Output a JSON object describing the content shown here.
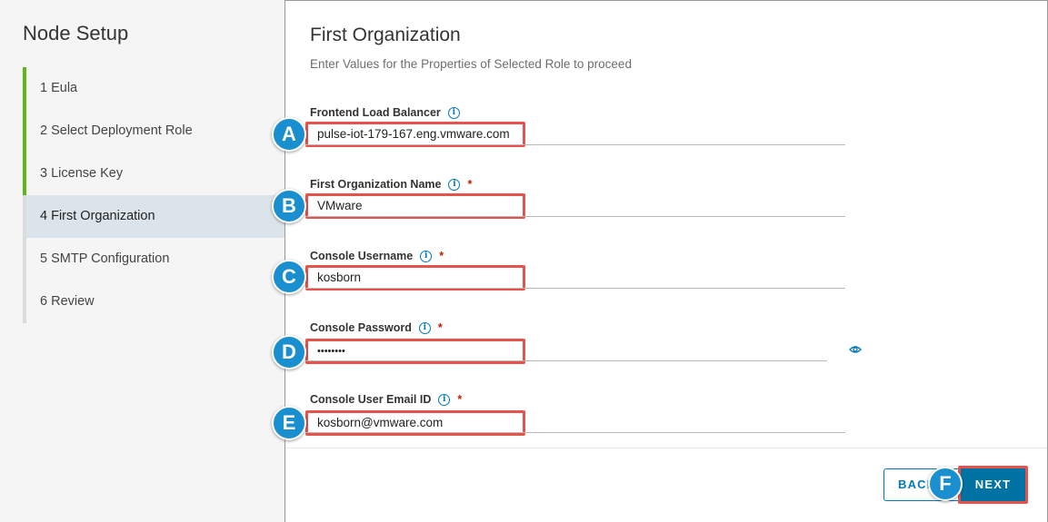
{
  "sidebar": {
    "title": "Node Setup",
    "steps": [
      {
        "label": "1  Eula"
      },
      {
        "label": "2  Select Deployment Role"
      },
      {
        "label": "3  License Key"
      },
      {
        "label": "4  First Organization"
      },
      {
        "label": "5  SMTP Configuration"
      },
      {
        "label": "6  Review"
      }
    ]
  },
  "main": {
    "title": "First Organization",
    "subtitle": "Enter Values for the Properties of Selected Role to proceed",
    "fields": [
      {
        "label": "Frontend Load Balancer",
        "required": "",
        "value": "pulse-iot-179-167.eng.vmware.com",
        "badge": "A"
      },
      {
        "label": "First Organization Name",
        "required": "*",
        "value": "VMware",
        "badge": "B"
      },
      {
        "label": "Console Username",
        "required": "*",
        "value": "kosborn",
        "badge": "C"
      },
      {
        "label": "Console Password",
        "required": "*",
        "value": "••••••••",
        "badge": "D"
      },
      {
        "label": "Console User Email ID",
        "required": "*",
        "value": "kosborn@vmware.com",
        "badge": "E"
      }
    ],
    "info_icon_glyph": "i",
    "back_label": "BACK",
    "next_label": "NEXT",
    "next_badge": "F"
  },
  "colors": {
    "accent": "#0079b8",
    "step_done": "#5eb715",
    "highlight": "#e5534b",
    "badge": "#1a8fd0"
  },
  "icons": [
    "info-icon",
    "eye-icon"
  ]
}
